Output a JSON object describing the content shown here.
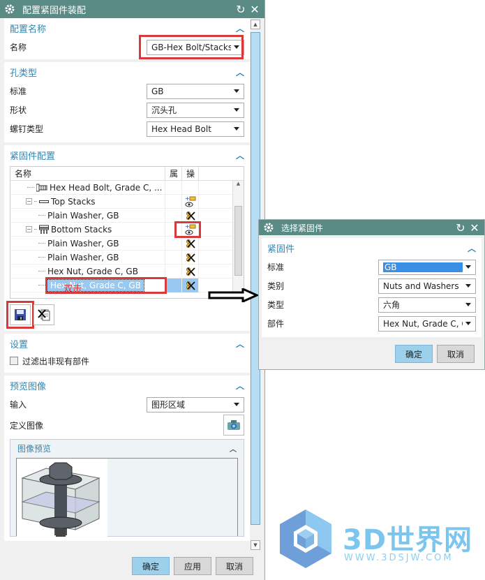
{
  "main_dialog": {
    "title": "配置紧固件装配",
    "sections": {
      "config_name": {
        "header": "配置名称",
        "name_label": "名称",
        "name_value": "GB-Hex Bolt/Stacks"
      },
      "hole_type": {
        "header": "孔类型",
        "fields": [
          {
            "label": "标准",
            "value": "GB"
          },
          {
            "label": "形状",
            "value": "沉头孔"
          },
          {
            "label": "螺钉类型",
            "value": "Hex Head Bolt"
          }
        ]
      },
      "fastener_config": {
        "header": "紧固件配置",
        "columns": [
          "名称",
          "属",
          "操"
        ],
        "rows": [
          {
            "name": "Hex Head Bolt, Grade C, ...",
            "icon": "bolt-icon",
            "action": "",
            "indent": 1
          },
          {
            "name": "Top Stacks",
            "icon": "stack-top-icon",
            "action": "add-fastener-icon",
            "indent": 1,
            "expandable": true
          },
          {
            "name": "Plain Washer, GB",
            "icon": "",
            "action": "remove-icon",
            "indent": 2
          },
          {
            "name": "Bottom Stacks",
            "icon": "stack-bottom-icon",
            "action": "add-fastener-icon",
            "indent": 1,
            "expandable": true
          },
          {
            "name": "Plain Washer, GB",
            "icon": "",
            "action": "remove-icon",
            "indent": 2
          },
          {
            "name": "Plain Washer, GB",
            "icon": "",
            "action": "remove-icon",
            "indent": 2
          },
          {
            "name": "Hex Nut, Grade C, GB",
            "icon": "",
            "action": "remove-icon",
            "indent": 2
          },
          {
            "name": "Hex Nut, Grade C, GB",
            "icon": "",
            "action": "remove-icon",
            "indent": 2,
            "selected": true
          }
        ],
        "annotation": "双击"
      },
      "settings": {
        "header": "设置",
        "filter_label": "过滤出非现有部件",
        "filter_checked": false
      },
      "preview_image": {
        "header": "预览图像",
        "input_label": "输入",
        "input_value": "图形区域",
        "define_label": "定义图像",
        "subpanel_header": "图像预览"
      }
    },
    "buttons": {
      "ok": "确定",
      "apply": "应用",
      "cancel": "取消"
    }
  },
  "select_dialog": {
    "title": "选择紧固件",
    "section_header": "紧固件",
    "fields": [
      {
        "label": "标准",
        "value": "GB"
      },
      {
        "label": "类别",
        "value": "Nuts and Washers"
      },
      {
        "label": "类型",
        "value": "六角"
      },
      {
        "label": "部件",
        "value": "Hex Nut, Grade C, G"
      }
    ],
    "buttons": {
      "ok": "确定",
      "cancel": "取消"
    }
  },
  "watermark": {
    "brand": "3D世界网",
    "url": "WWW.3DSJW.COM"
  },
  "colors": {
    "titlebar": "#5a8a84",
    "section_header": "#2f86b3",
    "highlight_red": "#d63a3a",
    "selection": "#99c9f0",
    "primary_button": "#9dd0ea"
  }
}
